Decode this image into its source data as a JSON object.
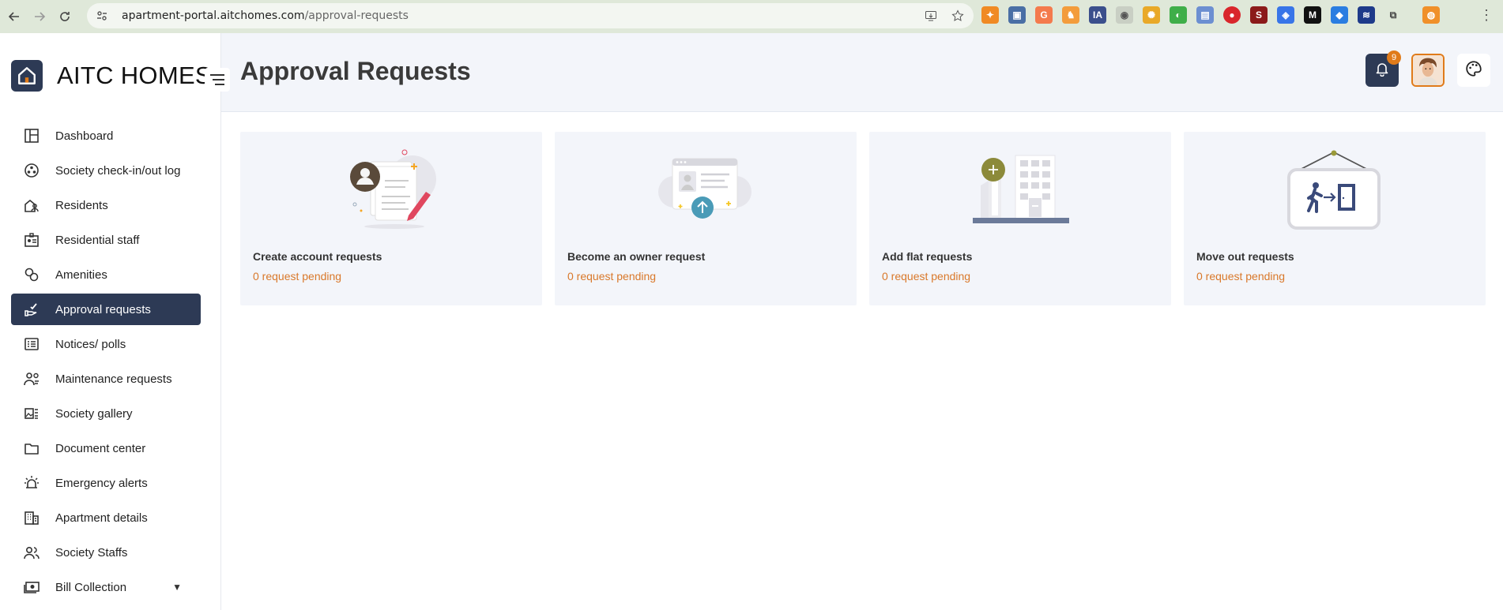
{
  "browser": {
    "url_host": "apartment-portal.aitchomes.com",
    "url_path": "/approval-requests"
  },
  "brand": {
    "name": "AITC HOMES"
  },
  "sidebar": {
    "items": [
      {
        "label": "Dashboard",
        "icon": "dashboard-icon"
      },
      {
        "label": "Society check-in/out log",
        "icon": "checkin-log-icon"
      },
      {
        "label": "Residents",
        "icon": "residents-icon"
      },
      {
        "label": "Residential staff",
        "icon": "staff-badge-icon"
      },
      {
        "label": "Amenities",
        "icon": "amenities-icon"
      },
      {
        "label": "Approval requests",
        "icon": "approval-hand-icon",
        "active": true
      },
      {
        "label": "Notices/ polls",
        "icon": "notices-icon"
      },
      {
        "label": "Maintenance requests",
        "icon": "maintenance-icon"
      },
      {
        "label": "Society gallery",
        "icon": "gallery-icon"
      },
      {
        "label": "Document center",
        "icon": "folder-icon"
      },
      {
        "label": "Emergency alerts",
        "icon": "alert-siren-icon"
      },
      {
        "label": "Apartment details",
        "icon": "building-icon"
      },
      {
        "label": "Society Staffs",
        "icon": "people-icon"
      },
      {
        "label": "Bill Collection",
        "icon": "money-icon",
        "has_dropdown": true
      }
    ]
  },
  "header": {
    "title": "Approval Requests",
    "notification_count": "9"
  },
  "cards": [
    {
      "title": "Create account requests",
      "status": "0 request pending",
      "illustration": "account-form-illustration"
    },
    {
      "title": "Become an owner request",
      "status": "0 request pending",
      "illustration": "owner-upload-illustration"
    },
    {
      "title": "Add flat requests",
      "status": "0 request pending",
      "illustration": "add-flat-building-illustration"
    },
    {
      "title": "Move out requests",
      "status": "0 request pending",
      "illustration": "move-out-sign-illustration"
    }
  ],
  "colors": {
    "accent_dark": "#2d3a55",
    "pending_orange": "#d9782a",
    "badge_orange": "#e07b1a"
  }
}
